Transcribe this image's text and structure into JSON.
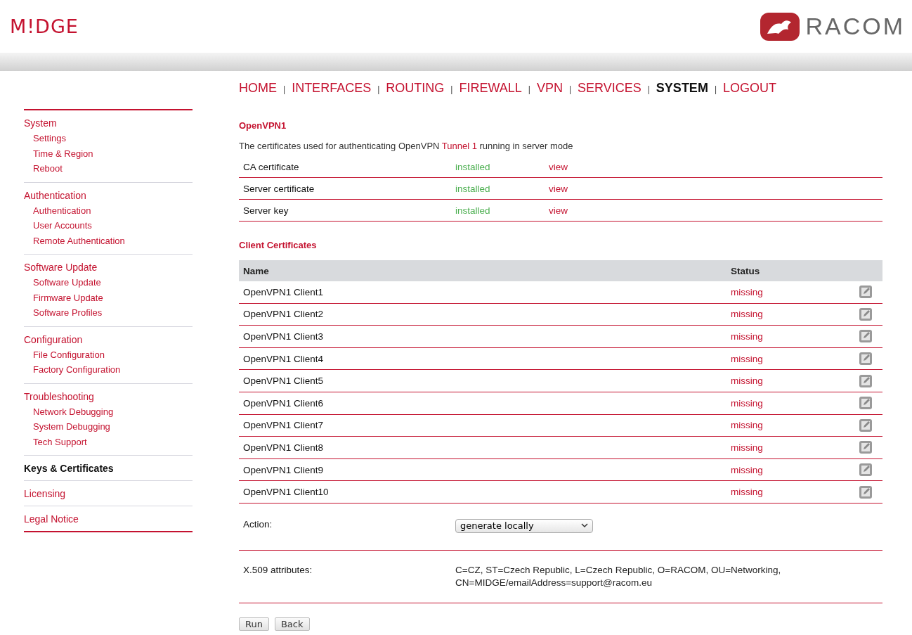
{
  "logo": {
    "product": "M!DGE",
    "vendor": "RACOM"
  },
  "nav": {
    "separator": "|",
    "items": [
      {
        "label": "HOME",
        "selected": false
      },
      {
        "label": "INTERFACES",
        "selected": false
      },
      {
        "label": "ROUTING",
        "selected": false
      },
      {
        "label": "FIREWALL",
        "selected": false
      },
      {
        "label": "VPN",
        "selected": false
      },
      {
        "label": "SERVICES",
        "selected": false
      },
      {
        "label": "SYSTEM",
        "selected": true
      },
      {
        "label": "LOGOUT",
        "selected": false
      }
    ]
  },
  "sidebar": {
    "groups": [
      {
        "title": "System",
        "selected": false,
        "items": [
          "Settings",
          "Time & Region",
          "Reboot"
        ]
      },
      {
        "title": "Authentication",
        "selected": false,
        "items": [
          "Authentication",
          "User Accounts",
          "Remote Authentication"
        ]
      },
      {
        "title": "Software Update",
        "selected": false,
        "items": [
          "Software Update",
          "Firmware Update",
          "Software Profiles"
        ]
      },
      {
        "title": "Configuration",
        "selected": false,
        "items": [
          "File Configuration",
          "Factory Configuration"
        ]
      },
      {
        "title": "Troubleshooting",
        "selected": false,
        "items": [
          "Network Debugging",
          "System Debugging",
          "Tech Support"
        ]
      },
      {
        "title": "Keys & Certificates",
        "selected": true
      },
      {
        "title": "Licensing",
        "selected": false
      },
      {
        "title": "Legal Notice",
        "selected": false
      }
    ]
  },
  "section_title": "OpenVPN1",
  "description": {
    "before": "The certificates used for authenticating OpenVPN ",
    "link": "Tunnel 1",
    "after": " running in server mode"
  },
  "certificates": [
    {
      "name": "CA certificate",
      "status": "installed",
      "action": "view"
    },
    {
      "name": "Server certificate",
      "status": "installed",
      "action": "view"
    },
    {
      "name": "Server key",
      "status": "installed",
      "action": "view"
    }
  ],
  "clients": {
    "title": "Client Certificates",
    "columns": [
      "Name",
      "Status"
    ],
    "rows": [
      {
        "name": "OpenVPN1 Client1",
        "status": "missing"
      },
      {
        "name": "OpenVPN1 Client2",
        "status": "missing"
      },
      {
        "name": "OpenVPN1 Client3",
        "status": "missing"
      },
      {
        "name": "OpenVPN1 Client4",
        "status": "missing"
      },
      {
        "name": "OpenVPN1 Client5",
        "status": "missing"
      },
      {
        "name": "OpenVPN1 Client6",
        "status": "missing"
      },
      {
        "name": "OpenVPN1 Client7",
        "status": "missing"
      },
      {
        "name": "OpenVPN1 Client8",
        "status": "missing"
      },
      {
        "name": "OpenVPN1 Client9",
        "status": "missing"
      },
      {
        "name": "OpenVPN1 Client10",
        "status": "missing"
      }
    ]
  },
  "action": {
    "label": "Action:",
    "value": "generate locally"
  },
  "x509": {
    "label": "X.509 attributes:",
    "value": "C=CZ, ST=Czech Republic, L=Czech Republic, O=RACOM, OU=Networking,\nCN=MIDGE/emailAddress=support@racom.eu"
  },
  "buttons": [
    "Run",
    "Back"
  ]
}
